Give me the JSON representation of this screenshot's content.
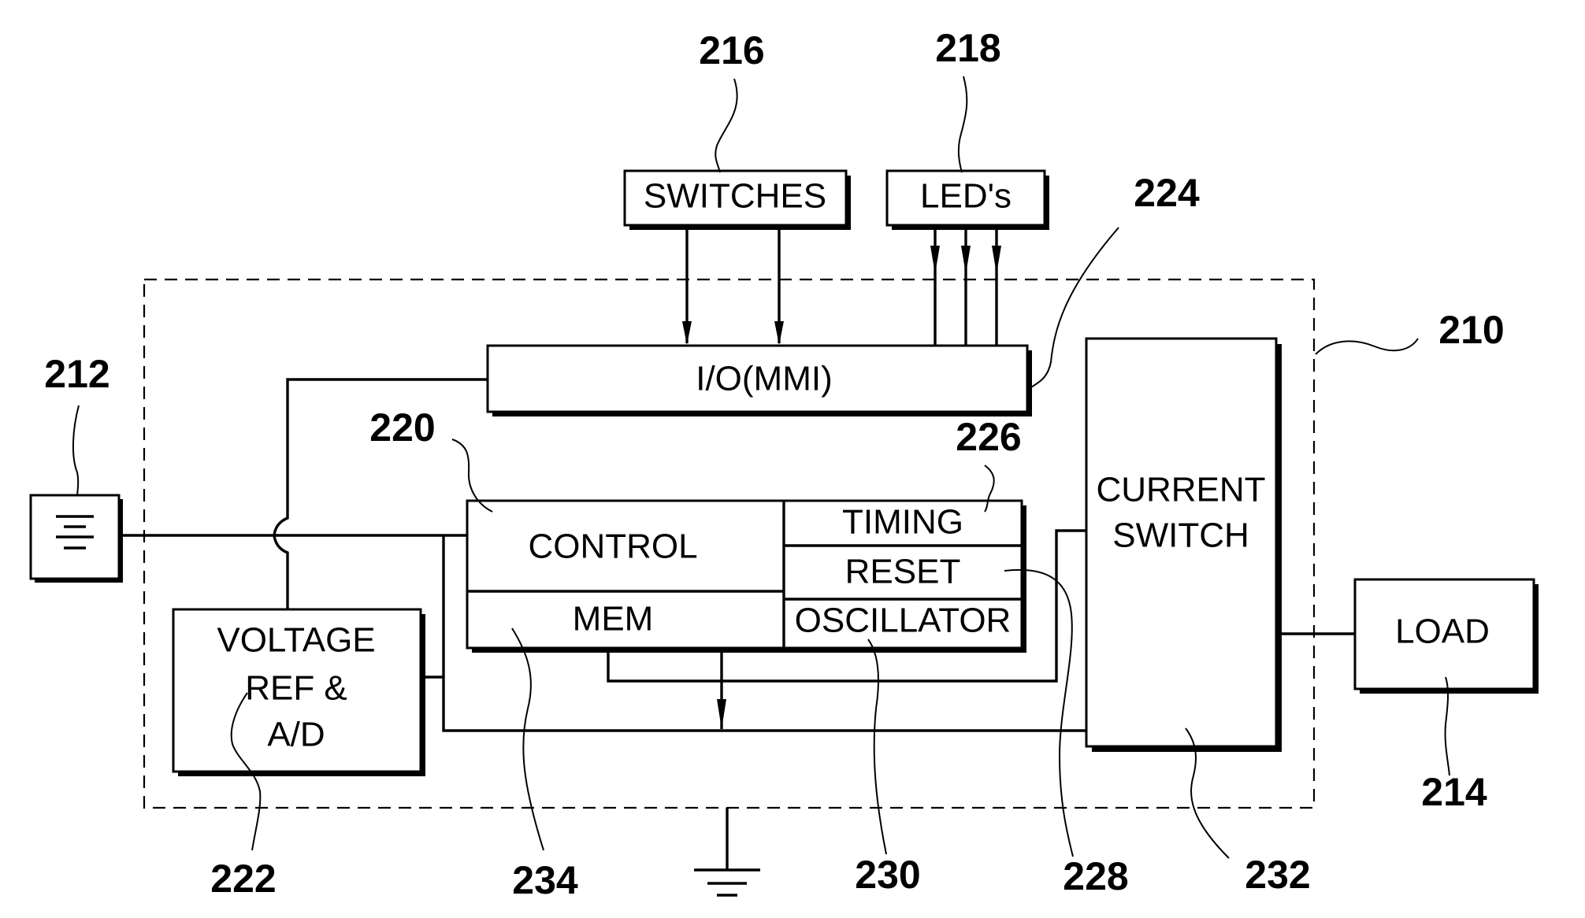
{
  "diagram": {
    "blocks": {
      "switches": "SWITCHES",
      "leds": "LED's",
      "io": "I/O(MMI)",
      "control": "CONTROL",
      "mem": "MEM",
      "timing": "TIMING",
      "reset": "RESET",
      "oscillator": "OSCILLATOR",
      "current_switch_line1": "CURRENT",
      "current_switch_line2": "SWITCH",
      "load": "LOAD",
      "voltage_ref_line1": "VOLTAGE",
      "voltage_ref_line2": "REF &",
      "voltage_ref_line3": "A/D"
    },
    "reference_numerals": {
      "system": "210",
      "battery": "212",
      "load": "214",
      "switches": "216",
      "leds": "218",
      "control": "220",
      "voltage_ref": "222",
      "io": "224",
      "timing": "226",
      "reset": "228",
      "oscillator": "230",
      "current_switch": "232",
      "mem": "234"
    },
    "symbols": {
      "battery": "battery-icon",
      "ground": "ground-icon"
    }
  }
}
